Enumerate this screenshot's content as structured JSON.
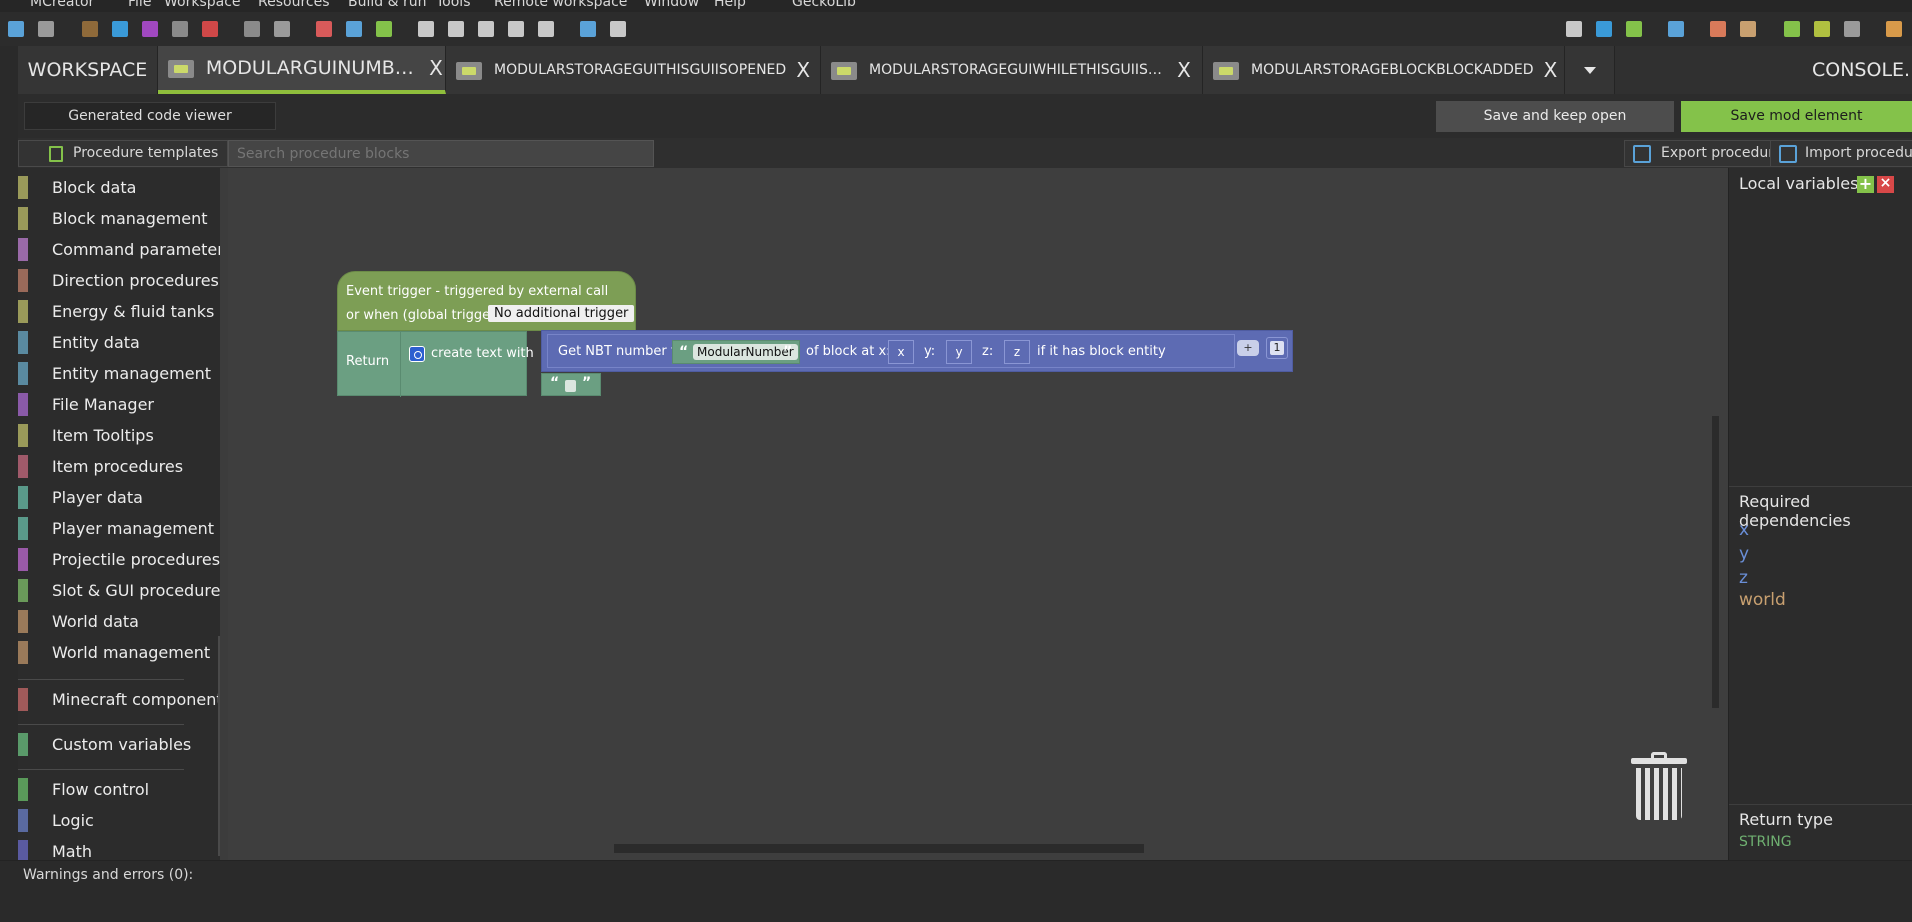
{
  "menu": [
    "MCreator",
    "File",
    "Workspace",
    "Resources",
    "Build & run",
    "Tools",
    "Remote workspace",
    "Window",
    "Help",
    "GeckoLib"
  ],
  "tabs": [
    {
      "label": "WORKSPACE"
    },
    {
      "label": "MODULARGUINUMBER"
    },
    {
      "label": "MODULARSTORAGEGUITHISGUIISOPENED"
    },
    {
      "label": "MODULARSTORAGEGUIWHILETHISGUIISO..."
    },
    {
      "label": "MODULARSTORAGEBLOCKBLOCKADDED"
    }
  ],
  "console_label": "CONSOLE.",
  "tab_close_glyph": "X",
  "actions": {
    "code_viewer": "Generated code viewer",
    "save_keep_open": "Save and keep open",
    "save_mod_element": "Save mod element"
  },
  "palette": {
    "procedure_templates": "Procedure templates",
    "search_placeholder": "Search procedure blocks",
    "export": "Export procedure",
    "import": "Import procedure"
  },
  "categories": [
    {
      "label": "Block data",
      "color": "#9a9a5a"
    },
    {
      "label": "Block management",
      "color": "#9a9a5a"
    },
    {
      "label": "Command parameters",
      "color": "#9a6aa8"
    },
    {
      "label": "Direction procedures",
      "color": "#9a6a5a"
    },
    {
      "label": "Energy & fluid tanks",
      "color": "#9a9a5a"
    },
    {
      "label": "Entity data",
      "color": "#5a8aa0"
    },
    {
      "label": "Entity management",
      "color": "#5a8aa0"
    },
    {
      "label": "File Manager",
      "color": "#8a5aa8"
    },
    {
      "label": "Item Tooltips",
      "color": "#9a9a5a"
    },
    {
      "label": "Item procedures",
      "color": "#a05a6a"
    },
    {
      "label": "Player data",
      "color": "#5a9a8a"
    },
    {
      "label": "Player management",
      "color": "#5a9a8a"
    },
    {
      "label": "Projectile procedures",
      "color": "#9a5aa8"
    },
    {
      "label": "Slot & GUI procedures",
      "color": "#6a9a5a"
    },
    {
      "label": "World data",
      "color": "#9a7a5a"
    },
    {
      "label": "World management",
      "color": "#9a7a5a"
    },
    {
      "label": "Minecraft components",
      "color": "#a05a5a"
    },
    {
      "label": "Custom variables",
      "color": "#5a9a6a"
    },
    {
      "label": "Flow control",
      "color": "#5a9a5a"
    },
    {
      "label": "Logic",
      "color": "#5a6aa0"
    },
    {
      "label": "Math",
      "color": "#5a5aa0"
    }
  ],
  "blocks": {
    "event_line1": "Event trigger - triggered by external call",
    "event_line2": "or when (global trigger):",
    "trigger_value": "No additional trigger",
    "return_label": "Return",
    "create_text": "create text with",
    "nbt_label": "Get NBT number tag",
    "tag_name": "ModularNumber",
    "of_block": "of block at x:",
    "x": "x",
    "y_label": "y:",
    "y": "y",
    "z_label": "z:",
    "z": "z",
    "if_entity": "if it has block entity",
    "plus": "+",
    "number": "1",
    "quote_open": "“",
    "quote_close": "”"
  },
  "right_panel": {
    "local_variables": "Local variables",
    "required_dependencies": "Required dependencies",
    "dependencies": [
      {
        "name": "x",
        "color": "#6a8fd8"
      },
      {
        "name": "y",
        "color": "#6a8fd8"
      },
      {
        "name": "z",
        "color": "#6a8fd8"
      },
      {
        "name": "world",
        "color": "#c8a070"
      }
    ],
    "return_type_label": "Return type",
    "return_type": "STRING"
  },
  "warnings": "Warnings and errors (0):"
}
